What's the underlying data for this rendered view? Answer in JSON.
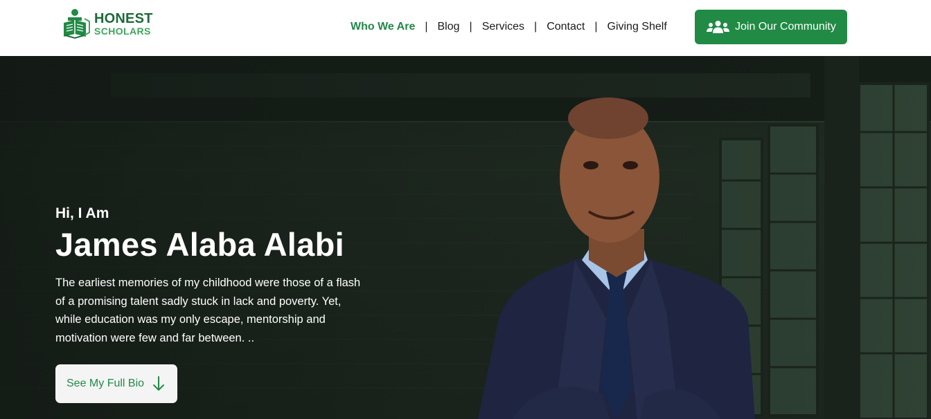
{
  "header": {
    "logo": {
      "line1": "HONEST",
      "line2": "SCHOLARS",
      "icon": "honest-scholars-logo"
    },
    "nav": [
      {
        "label": "Who We Are",
        "active": true
      },
      {
        "label": "Blog",
        "active": false
      },
      {
        "label": "Services",
        "active": false
      },
      {
        "label": "Contact",
        "active": false
      },
      {
        "label": "Giving Shelf",
        "active": false
      }
    ],
    "separator": "|",
    "cta": {
      "label": "Join Our Community",
      "icon": "users-icon"
    }
  },
  "hero": {
    "greeting": "Hi, I Am",
    "name": "James Alaba Alabi",
    "intro": "The earliest memories of my childhood were those of a flash of a promising talent sadly stuck in lack and poverty. Yet, while education was my only escape, mentorship and motivation were few and far between. ..",
    "button": {
      "label": "See My Full Bio",
      "icon": "arrow-down-icon"
    }
  },
  "colors": {
    "brand_green": "#218a45",
    "active_nav": "#23874a",
    "logo_dark": "#1c6a3a",
    "logo_light": "#3da55d"
  }
}
